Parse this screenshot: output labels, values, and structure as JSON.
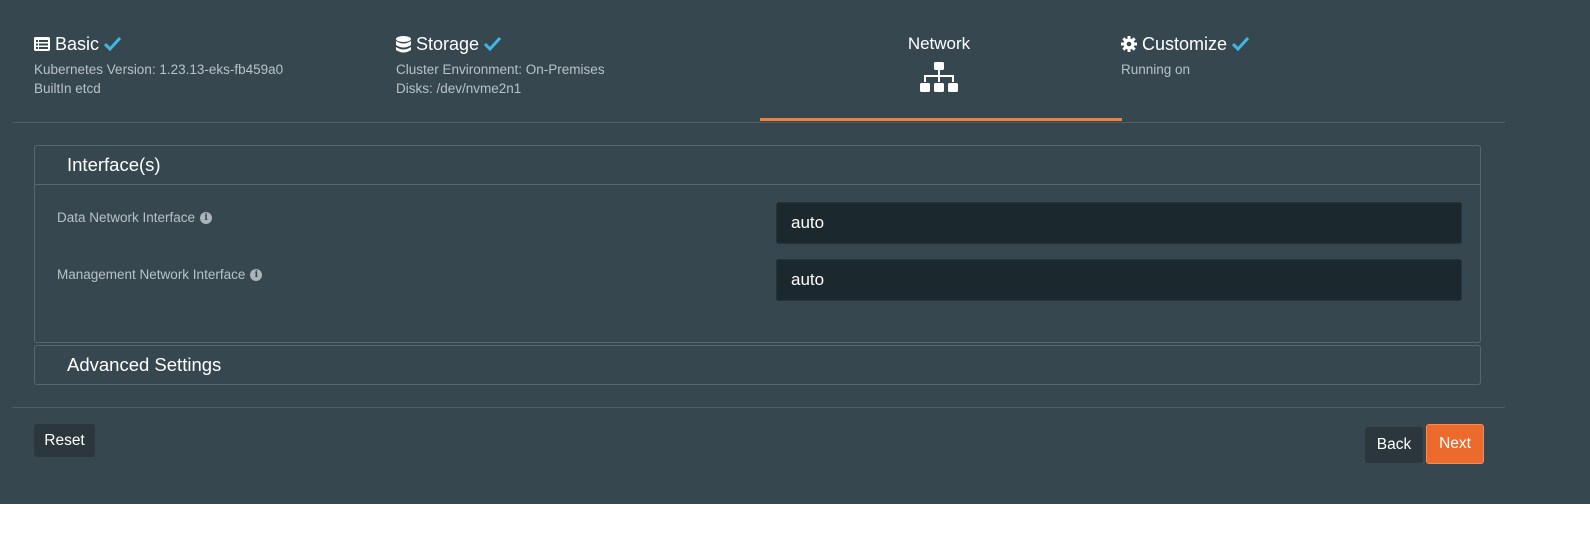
{
  "steps": {
    "basic": {
      "title": "Basic",
      "icon": "list-icon",
      "completed": true,
      "lines": [
        "Kubernetes Version: 1.23.13-eks-fb459a0",
        "BuiltIn etcd"
      ]
    },
    "storage": {
      "title": "Storage",
      "icon": "database-icon",
      "completed": true,
      "lines": [
        "Cluster Environment: On-Premises",
        "Disks: /dev/nvme2n1"
      ]
    },
    "network": {
      "title": "Network",
      "icon": "sitemap-icon",
      "active": true
    },
    "customize": {
      "title": "Customize",
      "icon": "gear-icon",
      "completed": true,
      "lines": [
        "Running on"
      ]
    }
  },
  "sections": {
    "interfaces": {
      "title": "Interface(s)",
      "fields": [
        {
          "label": "Data Network Interface",
          "value": "auto"
        },
        {
          "label": "Management Network Interface",
          "value": "auto"
        }
      ]
    },
    "advanced": {
      "title": "Advanced Settings"
    }
  },
  "buttons": {
    "reset": "Reset",
    "back": "Back",
    "next": "Next"
  },
  "colors": {
    "panel": "#37474f",
    "accent": "#f0803c",
    "check": "#3fb7e6",
    "input_bg": "#1b282e"
  }
}
